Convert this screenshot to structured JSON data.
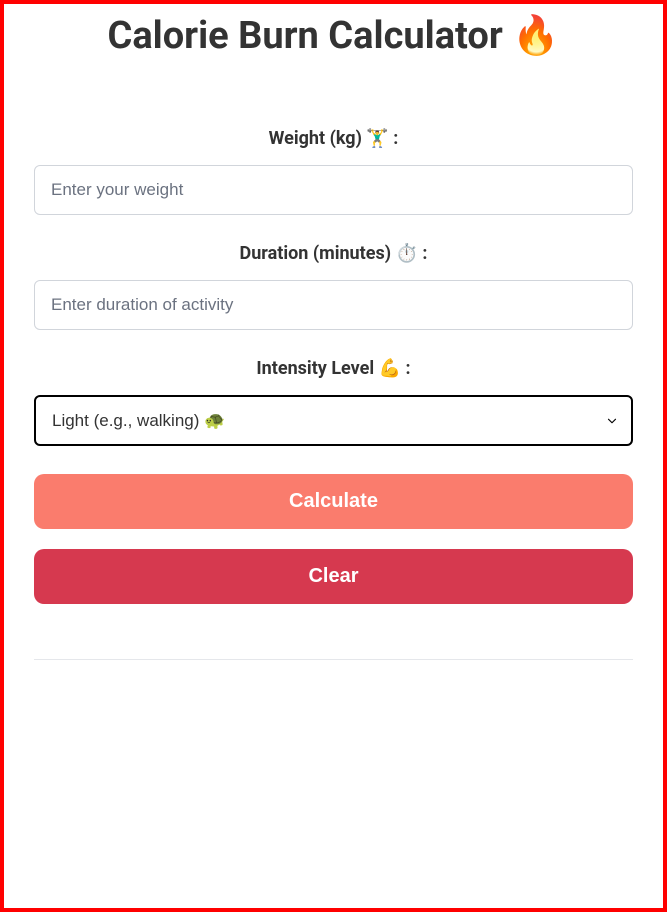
{
  "title": "Calorie Burn Calculator 🔥",
  "form": {
    "weight": {
      "label": "Weight (kg) 🏋️‍♂️ :",
      "placeholder": "Enter your weight",
      "value": ""
    },
    "duration": {
      "label": "Duration (minutes) ⏱️ :",
      "placeholder": "Enter duration of activity",
      "value": ""
    },
    "intensity": {
      "label": "Intensity Level 💪 :",
      "selected": "Light (e.g., walking) 🐢"
    }
  },
  "buttons": {
    "calculate": "Calculate",
    "clear": "Clear"
  }
}
